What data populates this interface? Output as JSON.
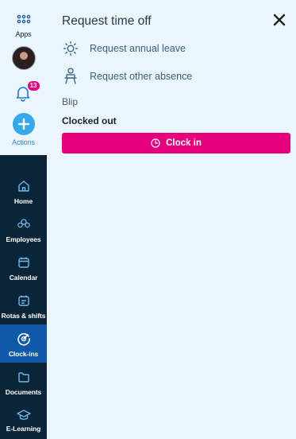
{
  "sidebar": {
    "apps_label": "Apps",
    "notifications_count": "13",
    "actions_label": "Actions",
    "items": [
      {
        "label": "Home",
        "icon": "home-icon"
      },
      {
        "label": "Employees",
        "icon": "employees-icon"
      },
      {
        "label": "Calendar",
        "icon": "calendar-icon"
      },
      {
        "label": "Rotas & shifts",
        "icon": "rotas-icon"
      },
      {
        "label": "Clock-ins",
        "icon": "clock-ins-icon",
        "active": true
      },
      {
        "label": "Documents",
        "icon": "folder-icon"
      },
      {
        "label": "E-Learning",
        "icon": "graduation-cap-icon"
      }
    ]
  },
  "panel": {
    "title": "Request time off",
    "links": [
      {
        "label": "Request annual leave",
        "icon": "sun-icon"
      },
      {
        "label": "Request other absence",
        "icon": "person-seat-icon"
      }
    ],
    "location": "Blip",
    "status": "Clocked out",
    "clock_in_label": "Clock in"
  },
  "colors": {
    "sidebar_bg": "#0b2538",
    "active_bg": "#0f5aa8",
    "accent_pink": "#e6007e",
    "panel_bg": "#eaf5fd",
    "actions_blue": "#33a8ea"
  }
}
